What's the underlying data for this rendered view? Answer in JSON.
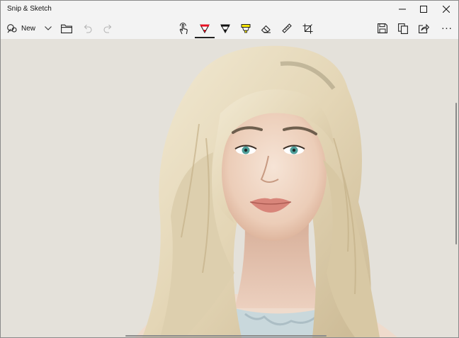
{
  "window": {
    "title": "Snip & Sketch"
  },
  "toolbar": {
    "new_label": "New",
    "more_label": "..."
  },
  "icons": {
    "new": "snip-icon",
    "new_dropdown": "chevron-down-icon",
    "open": "folder-icon",
    "undo": "undo-icon",
    "redo": "redo-icon",
    "touch": "touch-writing-icon",
    "ballpoint": "ballpoint-pen-icon",
    "pencil": "pencil-icon",
    "highlighter": "highlighter-icon",
    "eraser": "eraser-icon",
    "ruler": "ruler-icon",
    "crop": "crop-icon",
    "save": "save-icon",
    "copy": "copy-icon",
    "share": "share-icon",
    "more": "more-icon"
  },
  "colors": {
    "ballpoint_ink": "#e81123",
    "pencil_ink": "#111111",
    "highlighter_ink": "#f7e600",
    "canvas_bg": "#e4e1da"
  }
}
